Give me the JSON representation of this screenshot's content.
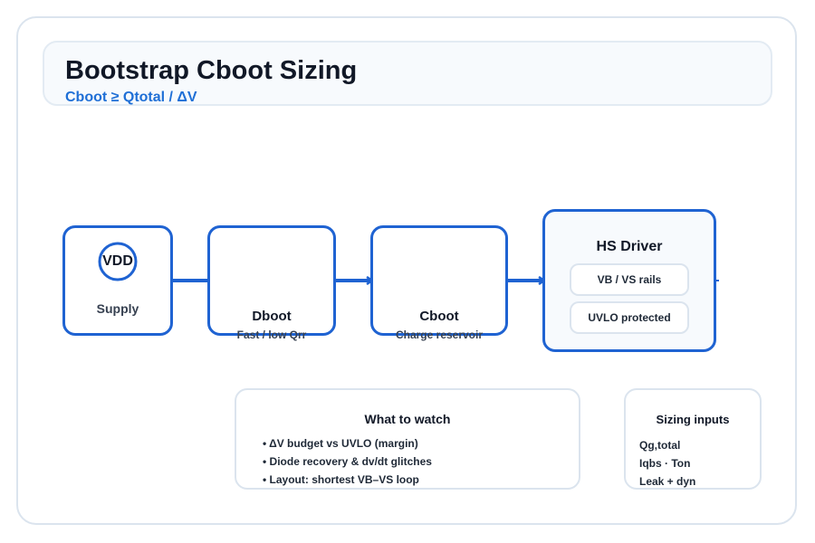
{
  "header": {
    "title": "Bootstrap Cboot Sizing",
    "subtitle": "Cboot ≥ Qtotal / ΔV"
  },
  "blocks": {
    "supply": {
      "symbol": "VDD",
      "label": "Supply"
    },
    "dboot": {
      "label": "Dboot",
      "sub": "Fast / low Qrr"
    },
    "cboot": {
      "label": "Cboot",
      "sub": "Charge reservoir"
    },
    "driver": {
      "label": "HS Driver",
      "pills": [
        "VB / VS rails",
        "UVLO protected"
      ]
    }
  },
  "watch": {
    "title": "What to watch",
    "items": [
      "• ΔV budget vs UVLO (margin)",
      "• Diode recovery & dv/dt glitches",
      "• Layout: shortest VB–VS loop"
    ]
  },
  "inputs": {
    "title": "Sizing inputs",
    "items": [
      "Qg,total",
      "Iqbs · Ton",
      "Leak + dyn"
    ]
  },
  "colors": {
    "accent": "#1f63d2",
    "subtitle": "#1f6fd6",
    "border": "#dbe4ee"
  }
}
